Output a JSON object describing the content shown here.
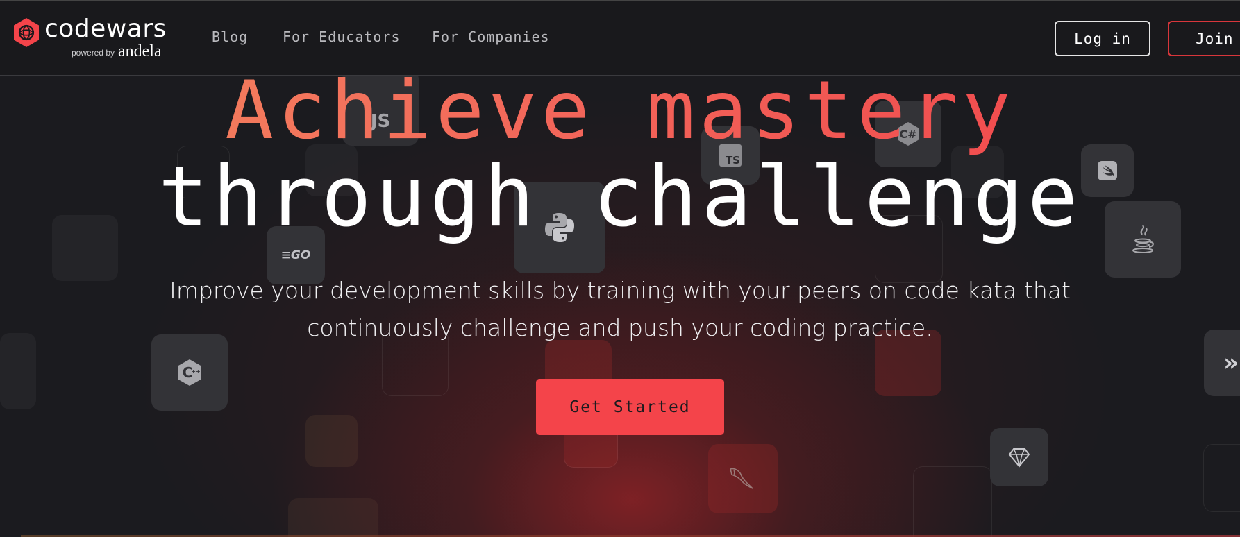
{
  "brand": {
    "wordmark": "codewars",
    "powered_by": "powered by",
    "partner": "andela",
    "accent": "#f4444a"
  },
  "nav": {
    "items": [
      {
        "label": "Blog"
      },
      {
        "label": "For Educators"
      },
      {
        "label": "For Companies"
      }
    ],
    "login_label": "Log in",
    "join_label": "Join"
  },
  "hero": {
    "line1": "Achieve mastery",
    "line2": "through challenge",
    "subtitle": "Improve your development skills by training with your peers on code kata that continuously challenge and push your coding practice.",
    "cta_label": "Get Started"
  },
  "tiles": {
    "js_label": "JS",
    "ts_label": "TS",
    "go_label": "GO",
    "icons": [
      "javascript-icon",
      "typescript-icon",
      "csharp-icon",
      "swift-icon",
      "python-icon",
      "go-icon",
      "java-icon",
      "cpp-icon",
      "kotlin-icon",
      "ruby-icon",
      "mysql-icon"
    ]
  },
  "colors": {
    "background": "#1b1b1f",
    "header_bg": "#19191c",
    "heading_gradient_start": "#f4875e",
    "heading_gradient_end": "#f04149",
    "cta_bg": "#f4444a"
  }
}
